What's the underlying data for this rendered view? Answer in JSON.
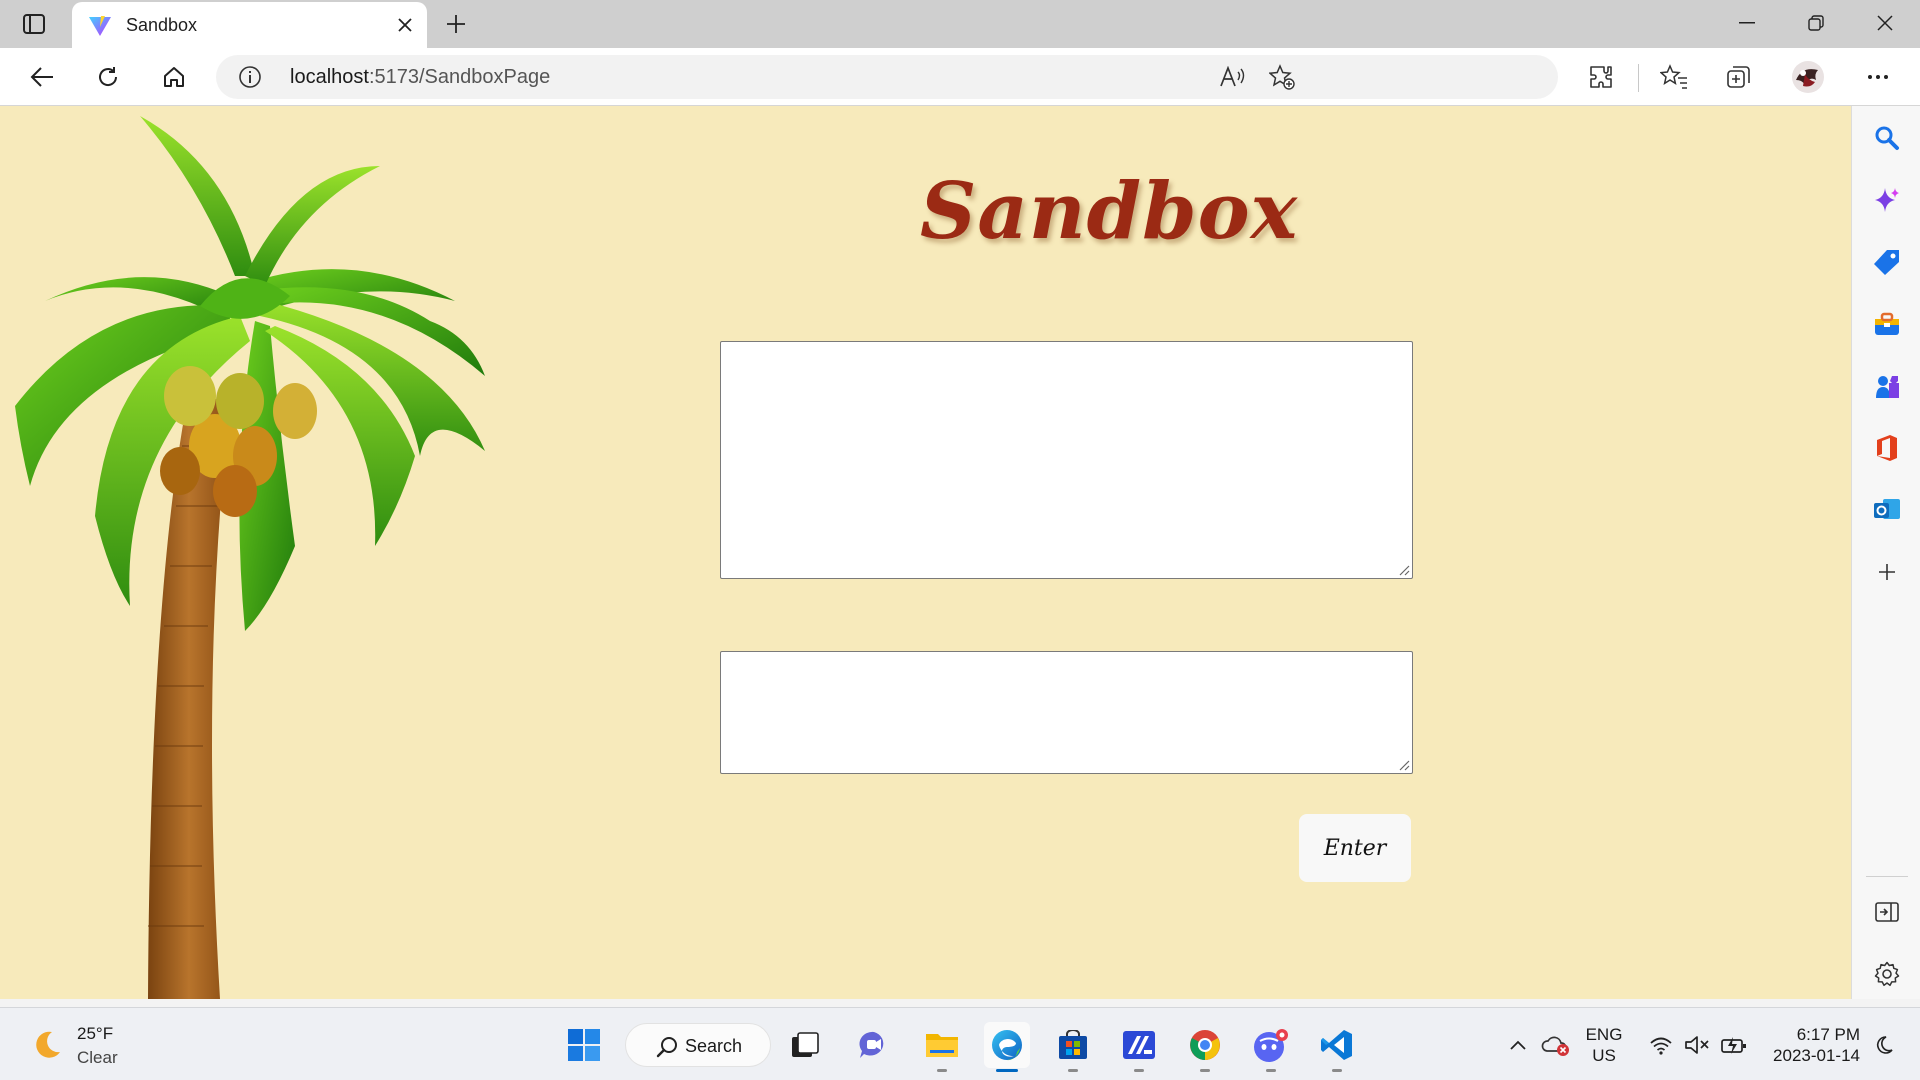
{
  "browser": {
    "tab_title": "Sandbox",
    "url_host": "localhost",
    "url_path": ":5173/SandboxPage"
  },
  "page": {
    "heading": "Sandbox",
    "input_top_value": "",
    "input_bottom_value": "",
    "enter_label": "Enter",
    "background_color": "#f7eabb",
    "heading_color": "#9b2a14"
  },
  "taskbar": {
    "weather_temp": "25°F",
    "weather_desc": "Clear",
    "search_label": "Search",
    "lang_line1": "ENG",
    "lang_line2": "US",
    "time": "6:17 PM",
    "date": "2023-01-14"
  }
}
